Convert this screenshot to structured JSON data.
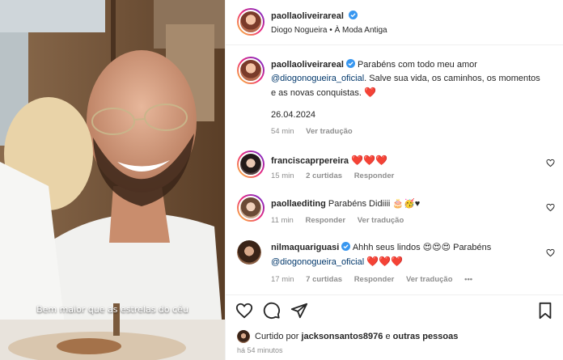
{
  "media": {
    "overlay_caption": "Bem maior que as estrelas do céu"
  },
  "header": {
    "username": "paollaoliveirareal",
    "subtitle_artist": "Diogo Nogueira",
    "subtitle_separator": "•",
    "subtitle_song": "À Moda Antiga"
  },
  "caption": {
    "username": "paollaoliveirareal",
    "text_part1": "Parabéns com todo meu amor",
    "mention": "@diogonogueira_oficial",
    "text_part2": ". Salve sua vida, os caminhos, os momentos e as novas conquistas.",
    "heart": "❤️",
    "date": "26.04.2024",
    "time": "54 min",
    "translate": "Ver tradução"
  },
  "comments": [
    {
      "username": "franciscaprpereira",
      "text": "❤️❤️❤️",
      "time": "15 min",
      "likes": "2 curtidas",
      "reply": "Responder"
    },
    {
      "username": "paollaediting",
      "text": "Parabéns Didiiii 🎂🥳♥",
      "time": "11 min",
      "reply": "Responder",
      "translate": "Ver tradução"
    },
    {
      "username": "nilmaquariguasi",
      "text_part1": "Ahhh seus lindos 😍😍😍 Parabéns",
      "mention": "@diogonogueira_oficial",
      "text_part2": "❤️❤️❤️",
      "time": "17 min",
      "likes": "7 curtidas",
      "reply": "Responder",
      "translate": "Ver tradução",
      "more": "•••"
    }
  ],
  "footer": {
    "liked_prefix": "Curtido por",
    "liked_user": "jacksonsantos8976",
    "liked_joiner": "e",
    "liked_others": "outras pessoas",
    "time_ago": "há 54 minutos"
  },
  "icons": {
    "verified": "verified-badge-icon",
    "like": "heart-outline-icon",
    "comment": "comment-bubble-icon",
    "share": "paper-plane-icon",
    "save": "bookmark-icon"
  },
  "colors": {
    "verified": "#3897f0",
    "mention": "#00376b",
    "heart": "#ed1c24",
    "meta": "#8e8e8e"
  }
}
